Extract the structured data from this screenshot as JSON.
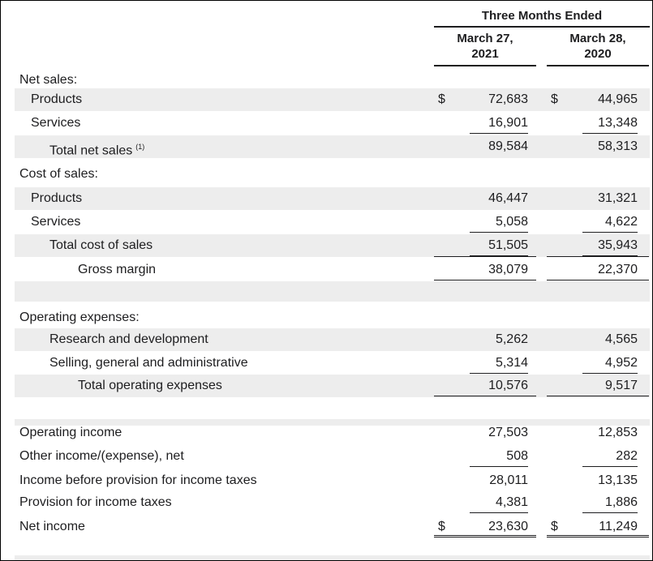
{
  "header": {
    "period": "Three Months Ended",
    "col1": "March 27, 2021",
    "col1_line1": "March 27,",
    "col1_line2": "2021",
    "col2_line1": "March 28,",
    "col2_line2": "2020"
  },
  "currency_symbol": "$",
  "rows": {
    "net_sales_header": {
      "label": "Net sales:"
    },
    "products_sales": {
      "label": "Products",
      "v1": "72,683",
      "v2": "44,965"
    },
    "services_sales": {
      "label": "Services",
      "v1": "16,901",
      "v2": "13,348"
    },
    "total_net_sales": {
      "label": "Total net sales",
      "note": "(1)",
      "v1": "89,584",
      "v2": "58,313"
    },
    "cost_header": {
      "label": "Cost of sales:"
    },
    "products_cost": {
      "label": "Products",
      "v1": "46,447",
      "v2": "31,321"
    },
    "services_cost": {
      "label": "Services",
      "v1": "5,058",
      "v2": "4,622"
    },
    "total_cost": {
      "label": "Total cost of sales",
      "v1": "51,505",
      "v2": "35,943"
    },
    "gross_margin": {
      "label": "Gross margin",
      "v1": "38,079",
      "v2": "22,370"
    },
    "opex_header": {
      "label": "Operating expenses:"
    },
    "rnd": {
      "label": "Research and development",
      "v1": "5,262",
      "v2": "4,565"
    },
    "sga": {
      "label": "Selling, general and administrative",
      "v1": "5,314",
      "v2": "4,952"
    },
    "total_opex": {
      "label": "Total operating expenses",
      "v1": "10,576",
      "v2": "9,517"
    },
    "operating_income": {
      "label": "Operating income",
      "v1": "27,503",
      "v2": "12,853"
    },
    "other_income": {
      "label": "Other income/(expense), net",
      "v1": "508",
      "v2": "282"
    },
    "income_before_tax": {
      "label": "Income before provision for income taxes",
      "v1": "28,011",
      "v2": "13,135"
    },
    "provision_tax": {
      "label": "Provision for income taxes",
      "v1": "4,381",
      "v2": "1,886"
    },
    "net_income": {
      "label": "Net income",
      "v1": "23,630",
      "v2": "11,249"
    }
  },
  "colors": {
    "shade": "#ededed",
    "text": "#1d1d1f"
  }
}
